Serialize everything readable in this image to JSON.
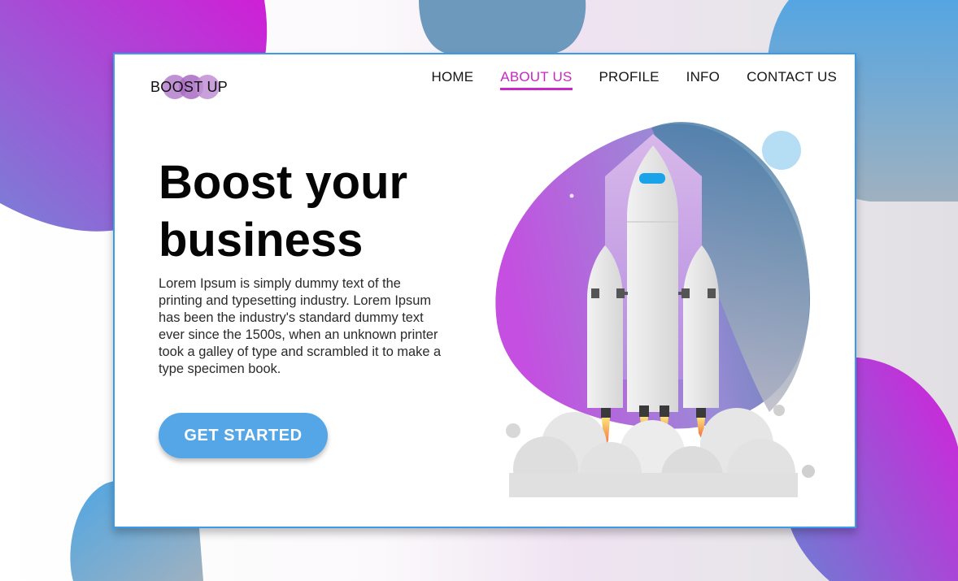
{
  "brand": {
    "logo_text": "BOOST UP"
  },
  "nav": {
    "items": [
      {
        "label": "HOME",
        "active": false
      },
      {
        "label": "ABOUT US",
        "active": true
      },
      {
        "label": "PROFILE",
        "active": false
      },
      {
        "label": "INFO",
        "active": false
      },
      {
        "label": "CONTACT US",
        "active": false
      }
    ]
  },
  "hero": {
    "title_line1": "Boost your",
    "title_line2": "business",
    "body": "Lorem Ipsum is simply dummy text of the printing and typesetting industry. Lorem Ipsum has been the industry's standard dummy text ever since the 1500s, when an unknown printer took a galley of type and scrambled it to make a type specimen book.",
    "cta_label": "GET STARTED"
  },
  "colors": {
    "accent_blue": "#3c9ae8",
    "button_blue": "#55a6e6",
    "accent_magenta": "#c826c6",
    "blob_purple": "#b44fd9",
    "blob_steel": "#4a7fa8"
  },
  "icons": [
    "rocket-icon",
    "cloud-icon",
    "logo-bubbles-icon"
  ]
}
